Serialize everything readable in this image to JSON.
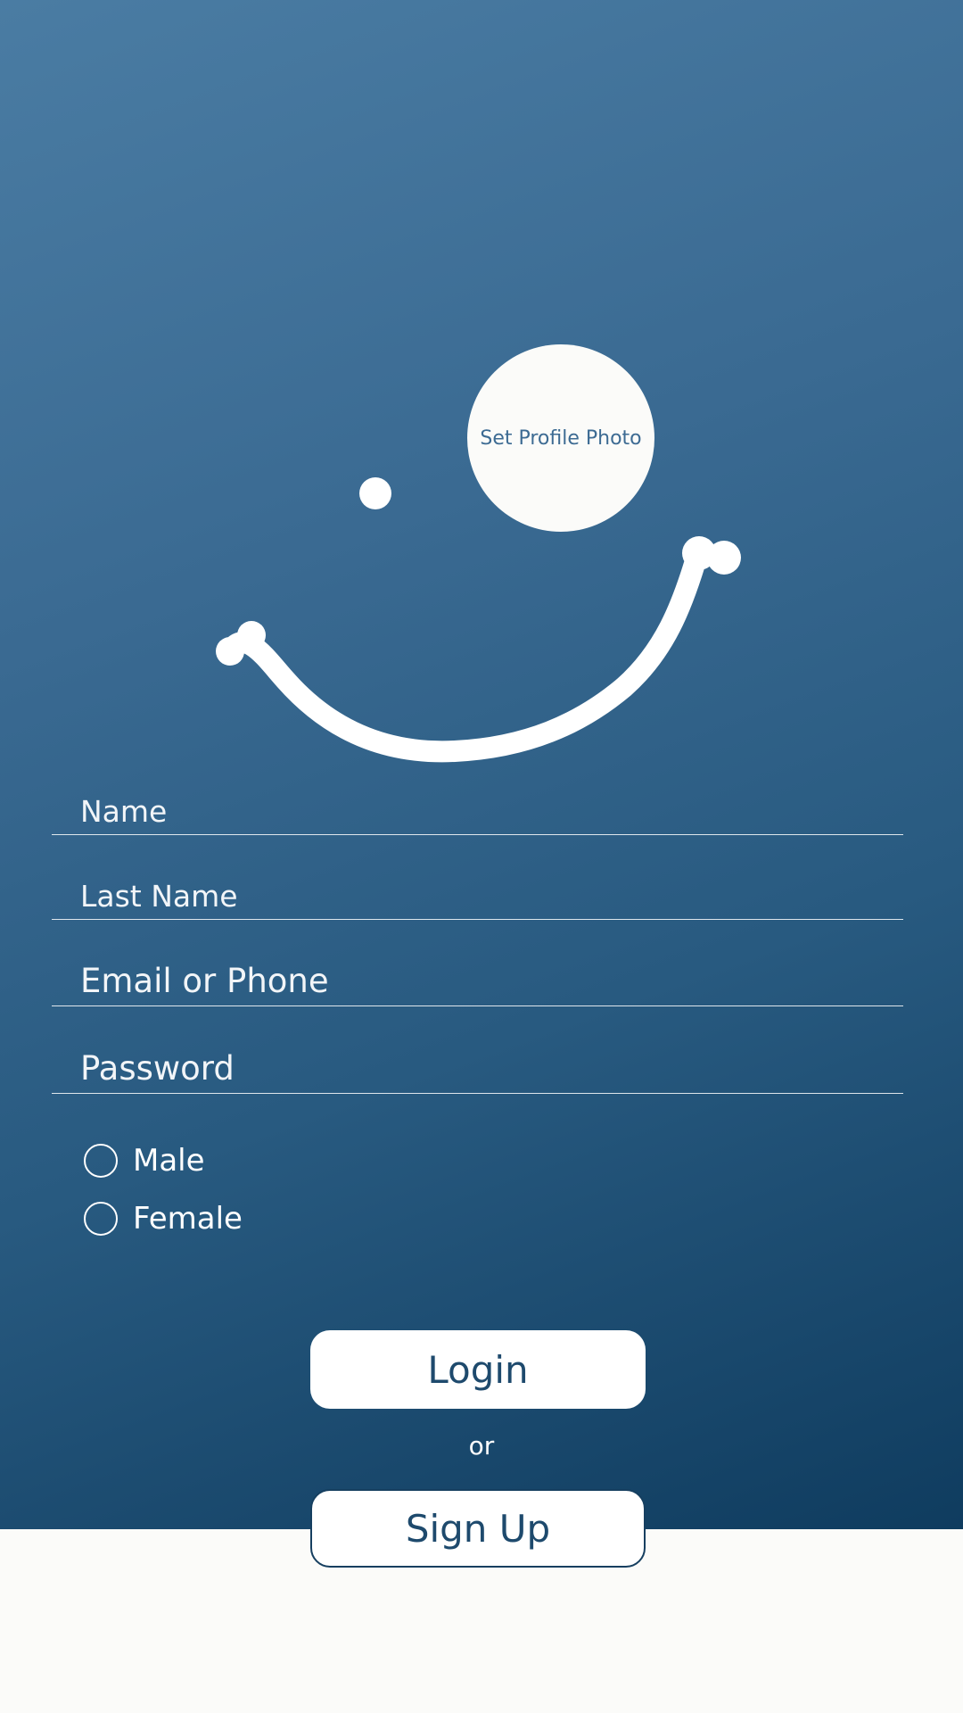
{
  "profile": {
    "set_photo_label": "Set Profile Photo"
  },
  "form": {
    "name_placeholder": "Name",
    "last_name_placeholder": "Last Name",
    "email_placeholder": "Email or Phone",
    "password_placeholder": "Password"
  },
  "gender": {
    "options": [
      "Male",
      "Female"
    ]
  },
  "actions": {
    "login_label": "Login",
    "or_label": "or",
    "signup_label": "Sign Up"
  },
  "colors": {
    "background_top": "#4a7ca3",
    "background_bottom": "#0f3c5f",
    "page_bottom": "#fbfbf9",
    "button_text": "#1e4a6d"
  }
}
